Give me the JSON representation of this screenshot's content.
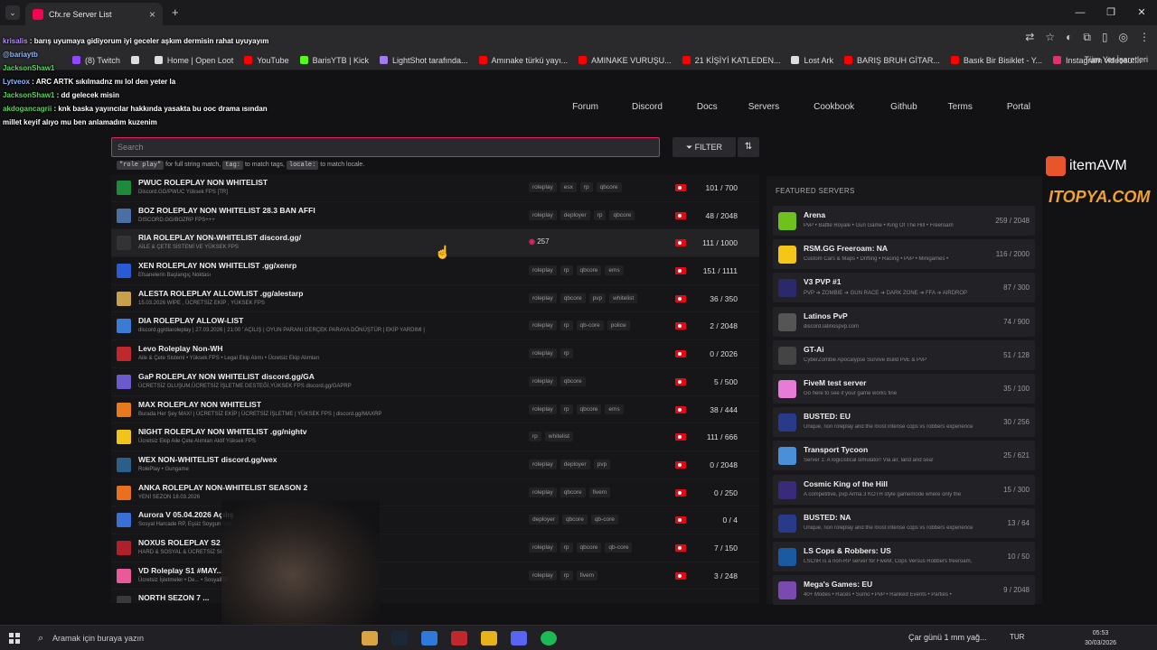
{
  "browser": {
    "tab_title": "Cfx.re Server List",
    "bookmarks": [
      {
        "label": "(8) Twitch",
        "color": "#9146ff"
      },
      {
        "label": "",
        "color": "#ddd"
      },
      {
        "label": "Home | Open Loot",
        "color": "#ddd"
      },
      {
        "label": "YouTube",
        "color": "#ff0000"
      },
      {
        "label": "BarisYTB | Kick",
        "color": "#53fc18"
      },
      {
        "label": "LightShot tarafında...",
        "color": "#a07cf0"
      },
      {
        "label": "Amınake türkü yayı...",
        "color": "#ff0000"
      },
      {
        "label": "AMINAKE VURUŞU...",
        "color": "#ff0000"
      },
      {
        "label": "21 KİŞİYİ KATLEDEN...",
        "color": "#ff0000"
      },
      {
        "label": "Lost Ark",
        "color": "#ddd"
      },
      {
        "label": "BARIŞ BRUH GİTAR...",
        "color": "#ff0000"
      },
      {
        "label": "Basık Bir Bisiklet - Y...",
        "color": "#ff0000"
      },
      {
        "label": "Instagram videosu:...",
        "color": "#e1306c"
      }
    ],
    "bookmarks_right": "Tüm Yer İşaretleri"
  },
  "nav": [
    "Forum",
    "Discord",
    "Docs",
    "Servers",
    "Cookbook",
    "Github",
    "Terms",
    "Portal"
  ],
  "search": {
    "placeholder": "Search",
    "filter_label": "FILTER"
  },
  "hint": {
    "p1": "\"role play\"",
    "t1": "for full string match,",
    "p2": "tag:",
    "t2": "to match tags,",
    "p3": "locale:",
    "t3": "to match locale."
  },
  "servers": [
    {
      "name": "PWUC ROLEPLAY NON WHITELIST",
      "sub": "Discord.GG/PWUC Yüksek FPS [TR]",
      "tags": [
        "roleplay",
        "esx",
        "rp",
        "qbcore"
      ],
      "players": "101 / 700",
      "color": "#1e8a3c"
    },
    {
      "name": "BOZ ROLEPLAY NON WHITELIST 28.3 BAN AFFI",
      "sub": "DISCORD.GG/BOZRP FPS+++",
      "tags": [
        "roleplay",
        "deployer",
        "rp",
        "qbcore"
      ],
      "players": "48 / 2048",
      "color": "#4a6fa5"
    },
    {
      "name": "RIA ROLEPLAY NON-WHITELIST discord.gg/",
      "sub": "AİLE & ÇETE SİSTEMİ VE YÜKSEK FPS",
      "tags": [],
      "boost": "257",
      "players": "111 / 1000",
      "color": "#333",
      "hl": true
    },
    {
      "name": "XEN ROLEPLAY NON WHITELIST .gg/xenrp",
      "sub": "Efsanelerin Başlangıç Noktası",
      "tags": [
        "roleplay",
        "rp",
        "qbcore",
        "ems"
      ],
      "players": "151 / 1111",
      "color": "#2a5bd7"
    },
    {
      "name": "ALESTA ROLEPLAY ALLOWLIST .gg/alestarp",
      "sub": "15.03.2026 WİPE , ÜCRETSİZ EKİP , YÜKSEK FPS",
      "tags": [
        "roleplay",
        "qbcore",
        "pvp",
        "whitelist"
      ],
      "players": "36 / 350",
      "color": "#c8a04a"
    },
    {
      "name": "DIA ROLEPLAY ALLOW-LIST",
      "sub": "discord.gg/diaroleplay | 27.03.2026 | 21:00 ' AÇILIŞ | OYUN PARANI GERÇEK PARAYA DÖNÜŞTÜR | EKİP YARDIMI |",
      "tags": [
        "roleplay",
        "rp",
        "qb-core",
        "police"
      ],
      "players": "2 / 2048",
      "color": "#3a7bd5"
    },
    {
      "name": "Levo Roleplay Non-WH",
      "sub": "Aile & Çete Sistemi • Yüksek FPS • Legal Ekip Alımı • Ücretsiz Ekip Alımları",
      "tags": [
        "roleplay",
        "rp"
      ],
      "players": "0 / 2026",
      "color": "#c0282d"
    },
    {
      "name": "GaP ROLEPLAY NON WHITELIST discord.gg/GA",
      "sub": "ÜCRETSİZ OLUŞUM,ÜCRETSİZ İŞLETME DESTEĞİ,YÜKSEK FPS discord.gg/GAPRP",
      "tags": [
        "roleplay",
        "qbcore"
      ],
      "players": "5 / 500",
      "color": "#6a5acd"
    },
    {
      "name": "MAX ROLEPLAY NON WHITELIST",
      "sub": "Burada Her Şey MAX! | ÜCRETSİZ EKİP | ÜCRETSİZ İŞLETME | YÜKSEK FPS | discord.gg/MAXRP",
      "tags": [
        "roleplay",
        "rp",
        "qbcore",
        "ems"
      ],
      "players": "38 / 444",
      "color": "#e87a1e"
    },
    {
      "name": "NIGHT ROLEPLAY NON WHITELIST .gg/nightv",
      "sub": "Ücretsiz Ekip Aile Çete Alımları Aktif Yüksek FPS",
      "tags": [
        "rp",
        "whitelist"
      ],
      "players": "111 / 666",
      "color": "#f0c419"
    },
    {
      "name": "WEX NON-WHITELIST discord.gg/wex",
      "sub": "RolePlay • Gungame",
      "tags": [
        "roleplay",
        "deployer",
        "pvp"
      ],
      "players": "0 / 2048",
      "color": "#2c5e8a"
    },
    {
      "name": "ANKA ROLEPLAY NON-WHITELIST SEASON 2",
      "sub": "YENİ SEZON 18.03.2026",
      "tags": [
        "roleplay",
        "qbcore",
        "fivem"
      ],
      "players": "0 / 250",
      "color": "#e8701e"
    },
    {
      "name": "Aurora V 05.04.2026 Açılış",
      "sub": "Sosyal Harcade RP, Eşsiz Soygun Sist...",
      "tags": [
        "deployer",
        "qbcore",
        "qb-core"
      ],
      "players": "0 / 4",
      "color": "#3a6fd8"
    },
    {
      "name": "NOXUS ROLEPLAY S2",
      "sub": "HARD & SOSYAL & ÜCRETSİZ SO...",
      "tags": [
        "roleplay",
        "rp",
        "qbcore",
        "qb-core"
      ],
      "players": "7 / 150",
      "color": "#b0202a"
    },
    {
      "name": "VD Roleplay S1 #MAY...",
      "sub": "Ücretsiz İşletmeler • De... • SosyalRP",
      "tags": [
        "roleplay",
        "rp",
        "fivem"
      ],
      "players": "3 / 248",
      "color": "#e85a9a"
    },
    {
      "name": "NORTH SEZON 7 ...",
      "sub": "",
      "tags": [],
      "players": "",
      "color": "#3a3a3a"
    }
  ],
  "featured": {
    "title": "FEATURED SERVERS",
    "items": [
      {
        "name": "Arena",
        "sub": "PvP • Battle Royale • Gun Game • King Of The Hill • Freeroam",
        "players": "259 / 2048",
        "color": "#6fc21e"
      },
      {
        "name": "RSM.GG Freeroam: NA",
        "sub": "Custom Cars & Maps • Drifting • Racing • PvP • Minigames •",
        "players": "116 / 2000",
        "color": "#f5c518"
      },
      {
        "name": "V3 PVP #1",
        "sub": "PVP ➔ ZOMBIE ➔ GUN RACE ➔ DARK ZONE ➔ FFA ➔ AIRDROP",
        "players": "87 / 300",
        "color": "#2a2a6a"
      },
      {
        "name": "Latinos PvP",
        "sub": "discord.latinospvp.com",
        "players": "74 / 900",
        "color": "#555"
      },
      {
        "name": "GT-Ai",
        "sub": "CyberZombie Apocalypse Survive Build PvE & PvP",
        "players": "51 / 128",
        "color": "#444"
      },
      {
        "name": "FiveM test server",
        "sub": "Go here to see if your game works fine",
        "players": "35 / 100",
        "color": "#e87ad8"
      },
      {
        "name": "BUSTED: EU",
        "sub": "Unique, non roleplay and the most intense cops vs robbers experience",
        "players": "30 / 256",
        "color": "#2a3a8a"
      },
      {
        "name": "Transport Tycoon",
        "sub": "Server 1: A logicistical simulator! Via air, land and sea!",
        "players": "25 / 621",
        "color": "#4a90d9"
      },
      {
        "name": "Cosmic King of the Hill",
        "sub": "A competitive, pvp Arma 3 KOTH style gamemode where only the",
        "players": "15 / 300",
        "color": "#3a2a7a"
      },
      {
        "name": "BUSTED: NA",
        "sub": "Unique, non roleplay and the most intense cops vs robbers experience",
        "players": "13 / 64",
        "color": "#2a3a8a"
      },
      {
        "name": "LS Cops & Robbers: US",
        "sub": "LSCnR is a non-RP server for FiveM, Cops Versus Robbers freeroam,",
        "players": "10 / 50",
        "color": "#1a5aa0"
      },
      {
        "name": "Mega's Games: EU",
        "sub": "40+ Modes • Races • Sumo • PvP • Ranked Events • Parties •",
        "players": "9 / 2048",
        "color": "#7a4ab0"
      }
    ]
  },
  "chat": [
    {
      "user": "krisalis",
      "msg": "barış uyumaya gidiyorum iyi geceler aşkım dermisin rahat uyuyayım",
      "cls": "u1"
    },
    {
      "user": "@bariaytb",
      "msg": "",
      "cls": "u3"
    },
    {
      "user": "JacksonShaw1",
      "msg": "",
      "cls": "u2"
    },
    {
      "user": "Lytveox",
      "msg": "ARC ARTK sıkılmadnz mı lol den yeter la",
      "cls": "u3"
    },
    {
      "user": "JacksonShaw1",
      "msg": "dd gelecek misin",
      "cls": "u2"
    },
    {
      "user": "akdogancagrii",
      "msg": "knk baska yayıncılar hakkında yasakta bu ooc drama ısından",
      "cls": "u4"
    },
    {
      "user": "",
      "msg": "millet keyif alıyo mu ben anlamadım kuzenim",
      "cls": ""
    }
  ],
  "overlay": {
    "brand1": "itemAVM",
    "brand2": "ITOPYA.COM"
  },
  "taskbar": {
    "search": "Aramak için buraya yazın",
    "weather": "Çar günü 1 mm yağ...",
    "lang": "TUR",
    "time": "05:53",
    "date": "30/03/2026"
  }
}
